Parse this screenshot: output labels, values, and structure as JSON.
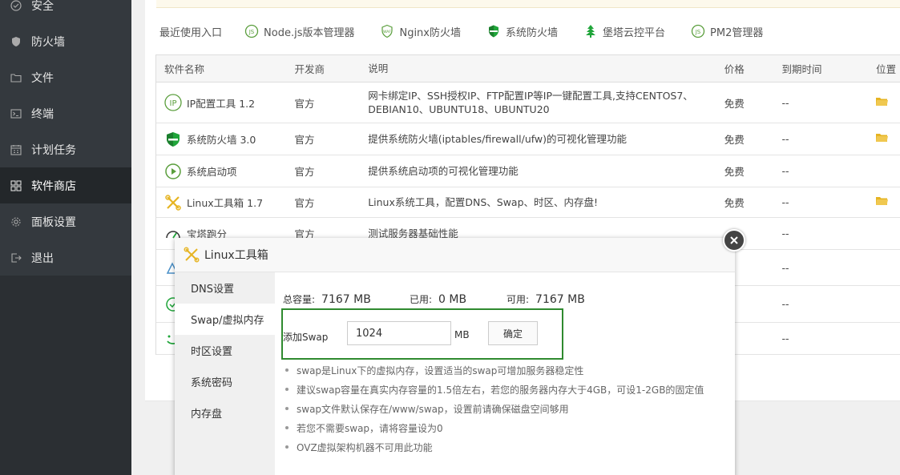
{
  "sidebar": {
    "items": [
      {
        "label": "安全",
        "icon": "shield-check-icon"
      },
      {
        "label": "防火墙",
        "icon": "shield-icon"
      },
      {
        "label": "文件",
        "icon": "folder-icon"
      },
      {
        "label": "终端",
        "icon": "terminal-icon"
      },
      {
        "label": "计划任务",
        "icon": "calendar-icon"
      },
      {
        "label": "软件商店",
        "icon": "grid-icon"
      },
      {
        "label": "面板设置",
        "icon": "gear-icon"
      },
      {
        "label": "退出",
        "icon": "logout-icon"
      }
    ]
  },
  "recent": {
    "label": "最近使用入口",
    "items": [
      {
        "label": "Node.js版本管理器",
        "icon": "nodejs-icon"
      },
      {
        "label": "Nginx防火墙",
        "icon": "waf-icon"
      },
      {
        "label": "系统防火墙",
        "icon": "shield-icon"
      },
      {
        "label": "堡塔云控平台",
        "icon": "tree-icon"
      },
      {
        "label": "PM2管理器",
        "icon": "pm2-icon"
      }
    ]
  },
  "table": {
    "headers": {
      "name": "软件名称",
      "dev": "开发商",
      "desc": "说明",
      "price": "价格",
      "expiry": "到期时间",
      "pos": "位置"
    },
    "rows": [
      {
        "name": "IP配置工具 1.2",
        "dev": "官方",
        "desc": "网卡绑定IP、SSH授权IP、FTP配置IP等IP一键配置工具,支持CENTOS7、DEBIAN10、UBUNTU18、UBUNTU20",
        "price": "免费",
        "expiry": "--"
      },
      {
        "name": "系统防火墙 3.0",
        "dev": "官方",
        "desc": "提供系统防火墙(iptables/firewall/ufw)的可视化管理功能",
        "price": "免费",
        "expiry": "--"
      },
      {
        "name": "系统启动项",
        "dev": "官方",
        "desc": "提供系统启动项的可视化管理功能",
        "price": "免费",
        "expiry": "--"
      },
      {
        "name": "Linux工具箱 1.7",
        "dev": "官方",
        "desc": "Linux系统工具，配置DNS、Swap、时区、内存盘!",
        "price": "免费",
        "expiry": "--"
      },
      {
        "name": "宝塔跑分",
        "dev": "官方",
        "desc": "测试服务器基础性能",
        "price": "",
        "expiry": "--"
      },
      {
        "name": "",
        "dev": "",
        "desc": "",
        "price": "费",
        "expiry": "--"
      },
      {
        "name": "",
        "dev": "",
        "desc": "",
        "price": "费",
        "expiry": "--"
      },
      {
        "name": "",
        "dev": "",
        "desc": "",
        "price": "费",
        "expiry": "--"
      }
    ]
  },
  "modal": {
    "title": "Linux工具箱",
    "tabs": [
      "DNS设置",
      "Swap/虚拟内存",
      "时区设置",
      "系统密码",
      "内存盘"
    ],
    "stats": {
      "total_label": "总容量:",
      "total_value": "7167 MB",
      "used_label": "已用:",
      "used_value": "0 MB",
      "avail_label": "可用:",
      "avail_value": "7167 MB"
    },
    "swap": {
      "label": "添加Swap",
      "value": "1024",
      "unit": "MB",
      "confirm": "确定"
    },
    "tips": [
      "swap是Linux下的虚拟内存，设置适当的swap可增加服务器稳定性",
      "建议swap容量在真实内存容量的1.5倍左右，若您的服务器内存大于4GB，可设1-2GB的固定值",
      "swap文件默认保存在/www/swap，设置前请确保磁盘空间够用",
      "若您不需要swap，请将容量设为0",
      "OVZ虚拟架构机器不可用此功能"
    ]
  },
  "colors": {
    "sidebar_bg": "#34393e",
    "accent_green": "#20a53a",
    "highlight_box": "#2f8a2f",
    "folder_yellow": "#e6b422"
  }
}
